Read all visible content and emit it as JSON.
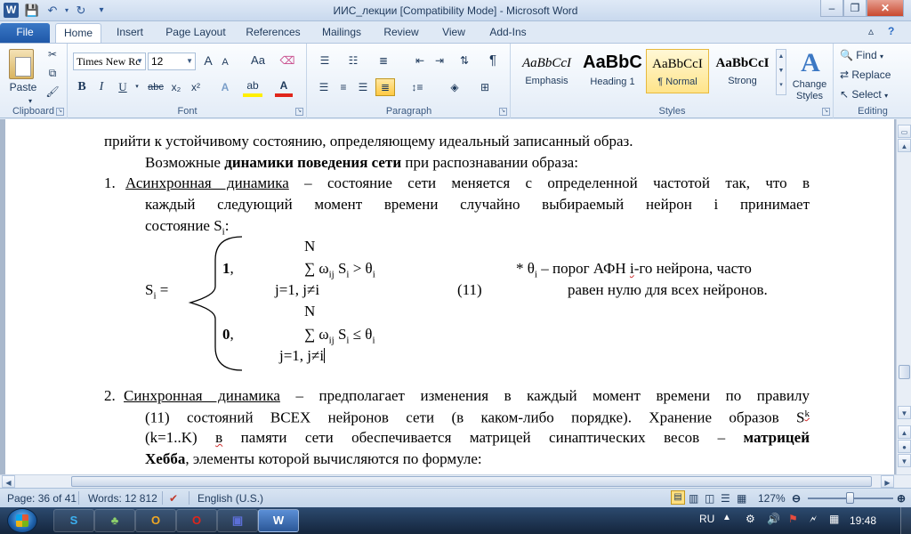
{
  "window": {
    "title": "ИИС_лекции [Compatibility Mode]  -  Microsoft Word",
    "minimize": "–",
    "maximize": "❐",
    "close": "✕"
  },
  "qat": {
    "logo": "W",
    "save": "💾",
    "undo": "↶",
    "redo": "↻",
    "customize": "▾"
  },
  "tabs": [
    "File",
    "Home",
    "Insert",
    "Page Layout",
    "References",
    "Mailings",
    "Review",
    "View",
    "Add-Ins"
  ],
  "ribbon": {
    "clipboard": {
      "label": "Clipboard",
      "paste": "Paste"
    },
    "font": {
      "label": "Font",
      "family": "Times New Rc",
      "size": "12",
      "grow": "A",
      "shrink": "A",
      "case": "Aa",
      "bold": "B",
      "italic": "I",
      "underline": "U",
      "strike": "abc",
      "sub": "x₂",
      "sup": "x²"
    },
    "paragraph": {
      "label": "Paragraph",
      "pilcrow": "¶"
    },
    "styles": {
      "label": "Styles",
      "items": [
        {
          "sample": "AaBbCcI",
          "name": "Emphasis"
        },
        {
          "sample": "AaBbC",
          "name": "Heading 1"
        },
        {
          "sample": "AaBbCcI",
          "name": "¶ Normal"
        },
        {
          "sample": "AaBbCcI",
          "name": "Strong"
        }
      ],
      "change_styles": "Change Styles"
    },
    "editing": {
      "label": "Editing",
      "find": "Find",
      "replace": "Replace",
      "select": "Select"
    }
  },
  "document": {
    "line1": "прийти к устойчивому состоянию, определяющему идеальный записанный образ.",
    "line2a": "Возможные ",
    "line2b": "динамики поведения сети",
    "line2c": " при распознавании образа:",
    "item1_num": "1.",
    "item1_title": "Асинхронная динамика",
    "item1_text": " – состояние сети меняется с определенной частотой так, что в",
    "item1_line2": "каждый следующий момент времени случайно выбираемый нейрон i принимает",
    "item1_line3_a": "состояние S",
    "item1_line3_sub": "i",
    "item1_line3_b": ":",
    "f_n1": "N",
    "f_case1": "1",
    "f_comma": ",",
    "f_sum1": "∑ ω",
    "f_sum1_sub": "ij",
    "f_sum1_b": " S",
    "f_sum1_sub2": "i",
    "f_sum1_c": " > θ",
    "f_sum1_sub3": "i",
    "f_note_a": "* θ",
    "f_note_sub": "i",
    "f_note_b": " – порог АФН ",
    "f_note_i": "i",
    "f_note_c": "-го нейрона, часто",
    "f_si_a": "S",
    "f_si_sub": "i",
    "f_si_b": " =",
    "f_j1": "j=1, j≠i",
    "f_eqnum": "(11)",
    "f_note2": "равен нулю для всех нейронов.",
    "f_n2": "N",
    "f_case0": "0",
    "f_sum2_c": " ≤ θ",
    "f_j2": "j=1, j≠i",
    "item2_num": "2.",
    "item2_title": "Синхронная динамика",
    "item2_text": " – предполагает изменения в каждый момент времени по правилу",
    "item2_line2_a": "(11) состояний ВСЕХ нейронов сети (в каком-либо порядке). Хранение образов S",
    "item2_line2_sup": "k",
    "item2_line3_a": "(k=1..K) ",
    "item2_line3_v": "в",
    "item2_line3_b": " памяти сети обеспечивается матрицей синаптических весов – ",
    "item2_line3_c": "матрицей",
    "item2_line4_a": "Хебба",
    "item2_line4_b": ", элементы которой вычисляются по формуле:"
  },
  "status": {
    "page": "Page: 36 of 41",
    "words": "Words: 12 812",
    "language": "English (U.S.)",
    "zoom": "127%",
    "zoom_level_percent": 127
  },
  "taskbar": {
    "lang": "RU",
    "time": "19:48"
  }
}
